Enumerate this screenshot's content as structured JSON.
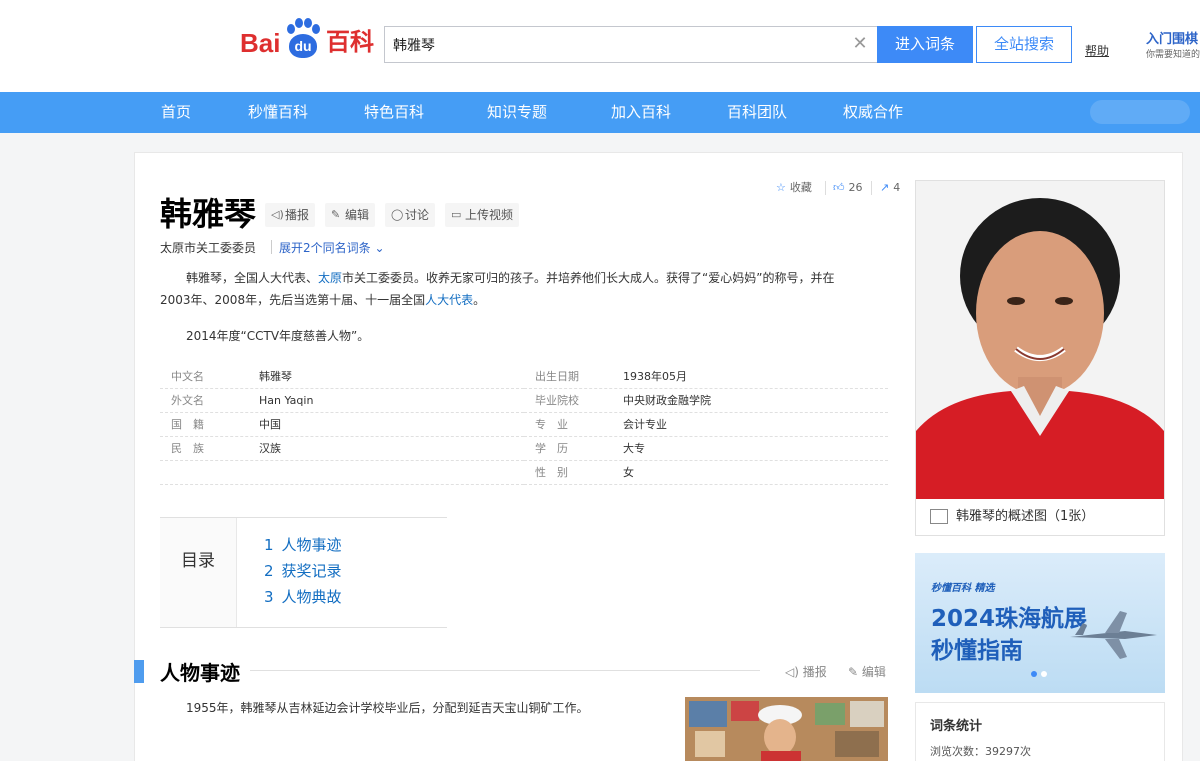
{
  "header": {
    "logo_bai": "Bai",
    "logo_du": "du",
    "logo_baike": "百科",
    "search_value": "韩雅琴",
    "enter_label": "进入词条",
    "all_search_label": "全站搜索",
    "help_label": "帮助",
    "promo_title": "入门围棋",
    "promo_sub": "你需要知道的"
  },
  "nav": {
    "items": [
      "首页",
      "秒懂百科",
      "特色百科",
      "知识专题",
      "加入百科",
      "百科团队",
      "权威合作"
    ]
  },
  "entry": {
    "title": "韩雅琴",
    "tools": [
      "播报",
      "编辑",
      "讨论",
      "上传视频"
    ],
    "collect_label": "收藏",
    "like_count": "26",
    "share_count": "4",
    "subtitle": "太原市关工委委员",
    "expand_label": "展开2个同名词条",
    "summary_p1": {
      "a": "韩雅琴，全国人大代表、",
      "link1": "太原",
      "b": "市关工委委员。收养无家可归的孩子。并培养他们长大成人。获得了“爱心妈妈”的称号，并在",
      "c": "2003年、2008年，先后当选第十届、十一届全国",
      "link2": "人大代表",
      "d": "。"
    },
    "summary_p2": "2014年度“CCTV年度慈善人物”。"
  },
  "infobox": {
    "left": [
      {
        "label": "中文名",
        "value": "韩雅琴"
      },
      {
        "label": "外文名",
        "value": "Han Yaqin"
      },
      {
        "label": "国　籍",
        "value": "中国"
      },
      {
        "label": "民　族",
        "value": "汉族"
      }
    ],
    "right": [
      {
        "label": "出生日期",
        "value": "1938年05月"
      },
      {
        "label": "毕业院校",
        "value": "中央财政金融学院"
      },
      {
        "label": "专　业",
        "value": "会计专业"
      },
      {
        "label": "学　历",
        "value": "大专"
      },
      {
        "label": "性　别",
        "value": "女"
      }
    ]
  },
  "catalog": {
    "head": "目录",
    "items": [
      {
        "num": "1",
        "label": "人物事迹"
      },
      {
        "num": "2",
        "label": "获奖记录"
      },
      {
        "num": "3",
        "label": "人物典故"
      }
    ]
  },
  "section": {
    "title": "人物事迹",
    "broadcast_label": "播报",
    "edit_label": "编辑",
    "text": "1955年，韩雅琴从吉林延边会计学校毕业后，分配到延吉天宝山铜矿工作。"
  },
  "sidebar": {
    "portrait_caption": "韩雅琴的概述图（1张）",
    "banner_brand": "秒懂百科 精选",
    "banner_line1": "2024珠海航展",
    "banner_line2": "秒懂指南",
    "stats_title": "词条统计",
    "stats_views": "浏览次数：39297次"
  },
  "colors": {
    "nav_blue": "#459df5",
    "brand_red": "#de2f2f",
    "link_blue": "#136ec2",
    "button_blue": "#3d8af7"
  }
}
